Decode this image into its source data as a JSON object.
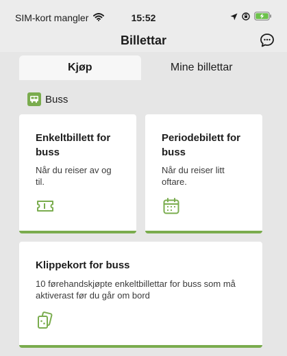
{
  "status_bar": {
    "carrier": "SIM-kort mangler",
    "time": "15:52"
  },
  "header": {
    "title": "Billettar"
  },
  "tabs": [
    {
      "label": "Kjøp",
      "active": true
    },
    {
      "label": "Mine billettar",
      "active": false
    }
  ],
  "section": {
    "label": "Buss",
    "icon": "bus-icon"
  },
  "cards": [
    {
      "title": "Enkeltbillett for buss",
      "description": "Når du reiser av og til.",
      "icon": "ticket-icon"
    },
    {
      "title": "Periodebilett for buss",
      "description": "Når du reiser litt oftare.",
      "icon": "calendar-icon"
    },
    {
      "title": "Klippekort for buss",
      "description": "10 førehandskjøpte enkeltbillettar for buss som må aktiverast før du går om bord",
      "icon": "cards-icon"
    }
  ],
  "colors": {
    "accent": "#7aac4e",
    "background": "#e6e6e6",
    "battery": "#6cc24a"
  }
}
